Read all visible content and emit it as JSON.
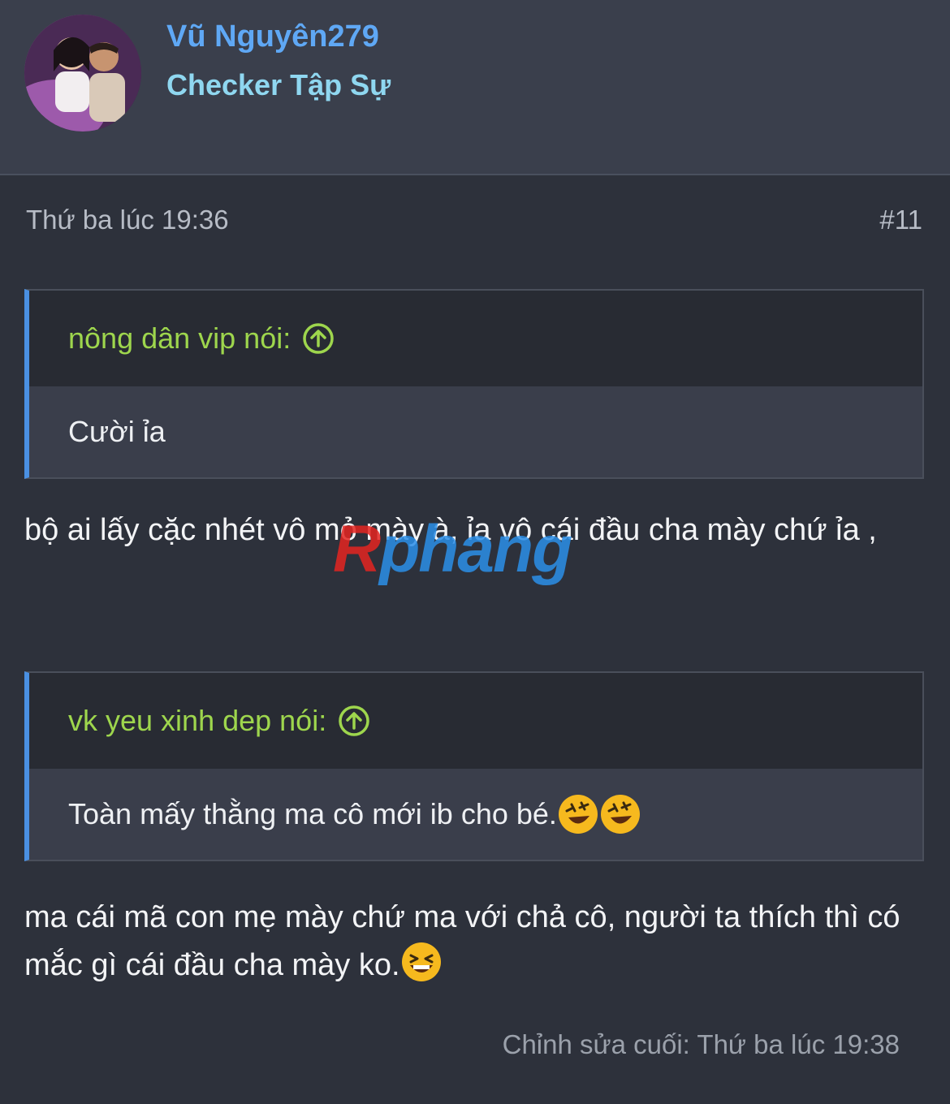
{
  "user": {
    "name": "Vũ Nguyên279",
    "title": "Checker Tập Sự"
  },
  "post": {
    "date": "Thứ ba lúc 19:36",
    "number": "#11",
    "quotes": [
      {
        "author_label": "nông dân vip nói:",
        "text": "Cười ỉa"
      },
      {
        "author_label": "vk yeu xinh dep nói:",
        "text": "Toàn mấy thằng ma cô mới ib cho bé."
      }
    ],
    "replies": [
      "bộ ai lấy cặc nhét vô mỏ mày à, ỉa vô cái đầu cha mày chứ ỉa ,",
      "ma cái mã con mẹ mày chứ ma với chả cô, người ta thích thì có mắc gì cái đầu cha mày ko."
    ],
    "edited": "Chỉnh sửa cuối: Thứ ba lúc 19:38"
  },
  "watermark": {
    "part1": "R",
    "part2": "phang"
  },
  "colors": {
    "username": "#5fa8f5",
    "user_title": "#8fd7f0",
    "quote_author": "#9ed64d",
    "quote_accent": "#4a90e2",
    "background": "#2d313b"
  },
  "icons": {
    "quote_jump": "circle-arrow-up-icon",
    "emoji_rofl": "rolling-on-floor-laughing-emoji",
    "emoji_grin": "grinning-squinting-emoji"
  }
}
